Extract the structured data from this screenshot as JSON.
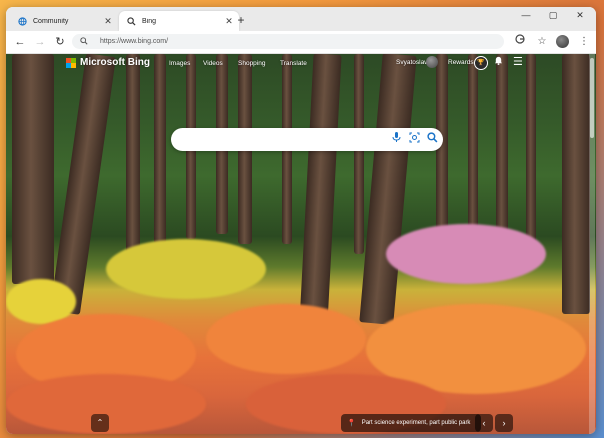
{
  "browser": {
    "tabs": [
      {
        "title": "Community",
        "icon": "globe-icon",
        "active": false
      },
      {
        "title": "Bing",
        "icon": "search-icon",
        "active": true
      }
    ],
    "address": {
      "url": "https://www.bing.com/"
    }
  },
  "bing": {
    "logo_text": "Microsoft Bing",
    "nav": [
      "Images",
      "Videos",
      "Shopping",
      "Translate"
    ],
    "user_name": "Svyatoslav",
    "rewards_label": "Rewards",
    "search_placeholder": "",
    "caption": "Part science experiment, part public park"
  },
  "colors": {
    "accent": "#1a73c8",
    "logo": [
      "#f25022",
      "#7fba00",
      "#00a4ef",
      "#ffb900"
    ]
  }
}
